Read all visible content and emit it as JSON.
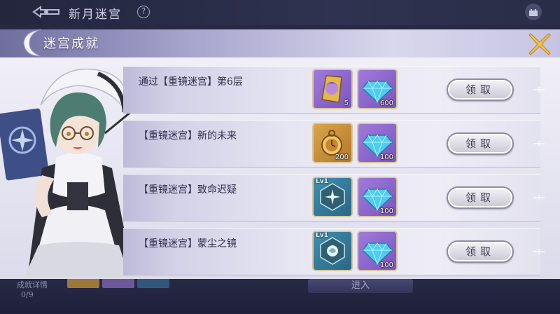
{
  "top_bar": {
    "title": "新月迷宫",
    "help_icon": "?"
  },
  "modal": {
    "title": "迷宫成就"
  },
  "colors": {
    "accent_gold": "#f2c04a",
    "header_purple": "#6f6e9e"
  },
  "rows": [
    {
      "title": "通过【重镜迷宫】第6层",
      "items": [
        {
          "type": "purple",
          "icon": "portrait-shard-icon",
          "count": "5"
        },
        {
          "type": "purple",
          "icon": "diamond-icon",
          "count": "600"
        }
      ],
      "claim": "领取"
    },
    {
      "title": "【重镜迷宫】新的未来",
      "items": [
        {
          "type": "gold",
          "icon": "pocket-watch-icon",
          "count": "200"
        },
        {
          "type": "purple",
          "icon": "diamond-icon",
          "count": "100"
        }
      ],
      "claim": "领取"
    },
    {
      "title": "【重镜迷宫】致命迟疑",
      "items": [
        {
          "type": "blue",
          "icon": "star-emblem-icon",
          "count": "",
          "level": "Lv1"
        },
        {
          "type": "purple",
          "icon": "diamond-icon",
          "count": "100"
        }
      ],
      "claim": "领取"
    },
    {
      "title": "【重镜迷宫】蒙尘之镜",
      "items": [
        {
          "type": "blue",
          "icon": "rose-emblem-icon",
          "count": "",
          "level": "Lv1"
        },
        {
          "type": "purple",
          "icon": "diamond-icon",
          "count": "100"
        }
      ],
      "claim": "领取"
    }
  ],
  "underlying": {
    "label": "成就详情",
    "progress": "0/9",
    "enter": "进入"
  }
}
